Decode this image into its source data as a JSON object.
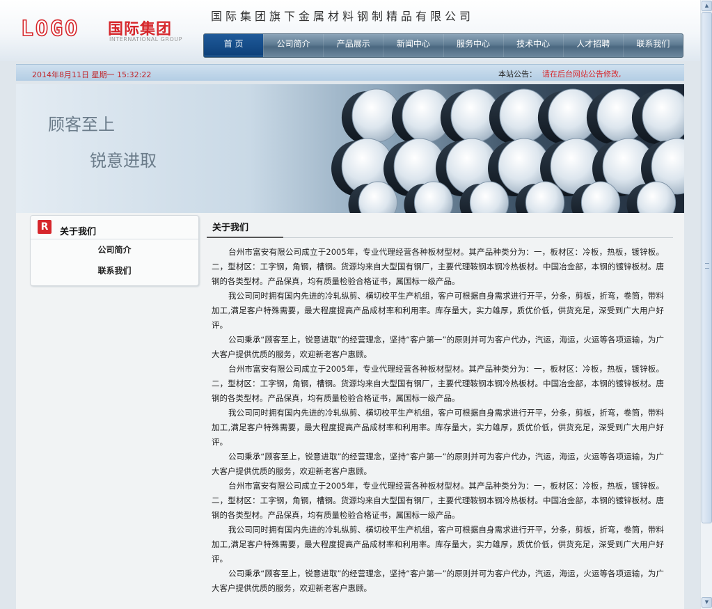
{
  "brand": {
    "logo_word": "LOGO",
    "name_cn": "国际集团",
    "name_en": "INTERNATIONAL GROUP",
    "company_full_name": "国际集团旗下金属材料钢制精品有限公司",
    "accent_color": "#d6262b"
  },
  "nav": {
    "items": [
      "首 页",
      "公司简介",
      "产品展示",
      "新闻中心",
      "服务中心",
      "技术中心",
      "人才招聘",
      "联系我们"
    ],
    "active_index": 0
  },
  "infobar": {
    "datetime": "2014年8月11日 星期一 15:32:22",
    "notice_label": "本站公告：",
    "notice_text": "请在后台网站公告修改,"
  },
  "banner": {
    "slogan_1": "顾客至上",
    "slogan_2": "锐意进取"
  },
  "sidebar": {
    "title": "关于我们",
    "icon_letter": "R",
    "links": [
      "公司简介",
      "联系我们"
    ]
  },
  "content": {
    "title": "关于我们",
    "paragraphs": [
      "台州市富安有限公司成立于2005年，专业代理经营各种板材型材。其产品种类分为：一，板材区：冷板，热板，镀锌板。二，型材区：工字钢，角钢，槽钢。货源均来自大型国有钢厂，主要代理鞍钢本钢冷热板材。中国冶金部，本钢的镀锌板材。唐钢的各类型材。产品保真，均有质量检验合格证书，属国标一级产品。",
      "我公司同时拥有国内先进的冷轧纵剪、横切校平生产机组，客户可根据自身需求进行开平，分条，剪板，折弯，卷筒，带料加工,满足客户特殊需要，最大程度提高产品成材率和利用率。库存量大，实力雄厚，质优价低，供货充足，深受到广大用户好评。",
      "公司秉承“顾客至上，锐意进取”的经营理念，坚持“客户第一”的原则并可为客户代办，汽运，海运，火运等各项运输，为广大客户提供优质的服务，欢迎新老客户惠顾。",
      "台州市富安有限公司成立于2005年，专业代理经营各种板材型材。其产品种类分为：一，板材区：冷板，热板，镀锌板。二，型材区：工字钢，角钢，槽钢。货源均来自大型国有钢厂，主要代理鞍钢本钢冷热板材。中国冶金部，本钢的镀锌板材。唐钢的各类型材。产品保真，均有质量检验合格证书，属国标一级产品。",
      "我公司同时拥有国内先进的冷轧纵剪、横切校平生产机组，客户可根据自身需求进行开平，分条，剪板，折弯，卷筒，带料加工,满足客户特殊需要，最大程度提高产品成材率和利用率。库存量大，实力雄厚，质优价低，供货充足，深受到广大用户好评。",
      "公司秉承“顾客至上，锐意进取”的经营理念，坚持“客户第一”的原则并可为客户代办，汽运，海运，火运等各项运输，为广大客户提供优质的服务，欢迎新老客户惠顾。",
      "台州市富安有限公司成立于2005年，专业代理经营各种板材型材。其产品种类分为：一，板材区：冷板，热板，镀锌板。二，型材区：工字钢，角钢，槽钢。货源均来自大型国有钢厂，主要代理鞍钢本钢冷热板材。中国冶金部，本钢的镀锌板材。唐钢的各类型材。产品保真，均有质量检验合格证书，属国标一级产品。",
      "我公司同时拥有国内先进的冷轧纵剪、横切校平生产机组，客户可根据自身需求进行开平，分条，剪板，折弯，卷筒，带料加工,满足客户特殊需要，最大程度提高产品成材率和利用率。库存量大，实力雄厚，质优价低，供货充足，深受到广大用户好评。",
      "公司秉承“顾客至上，锐意进取”的经营理念，坚持“客户第一”的原则并可为客户代办，汽运，海运，火运等各项运输，为广大客户提供优质的服务，欢迎新老客户惠顾。"
    ]
  },
  "scrollbar": {
    "position_fraction": 0.0,
    "visible_fraction": 0.86
  }
}
